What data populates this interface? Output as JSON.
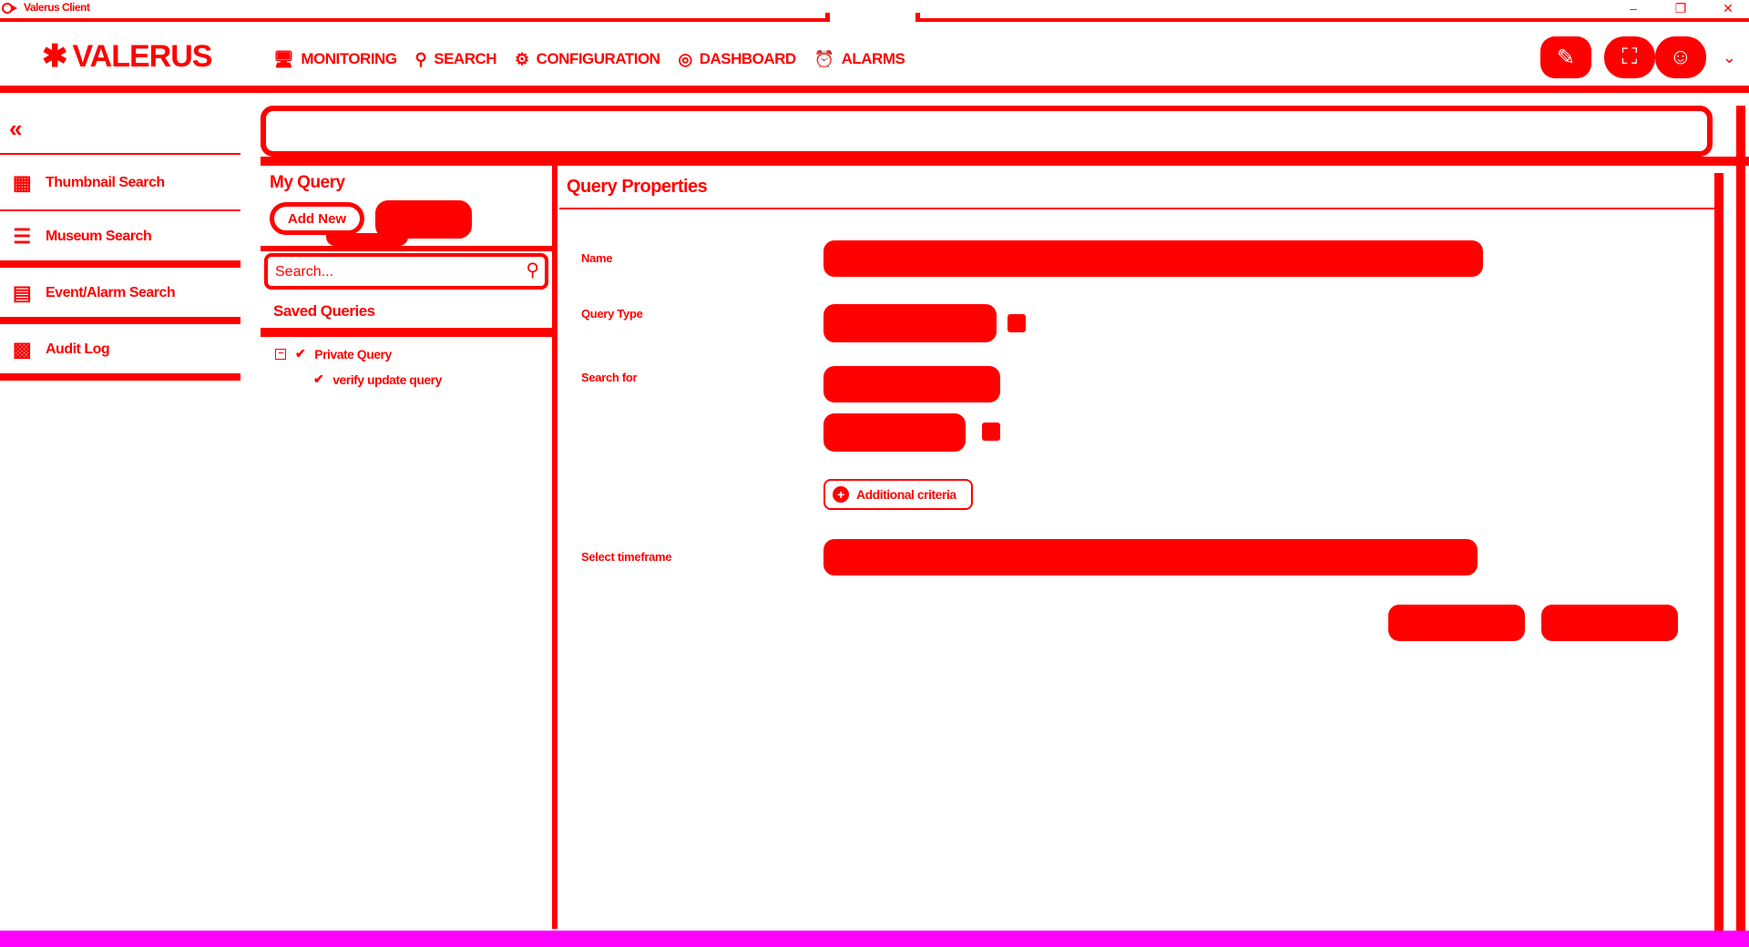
{
  "window": {
    "title": "Valerus Client",
    "controls": [
      "–",
      "❐",
      "✕"
    ]
  },
  "header": {
    "logo_text": "VALERUS",
    "nav": [
      {
        "label": "MONITORING",
        "icon": "monitor-icon"
      },
      {
        "label": "SEARCH",
        "icon": "search-icon",
        "active": true
      },
      {
        "label": "CONFIGURATION",
        "icon": "configuration-icon"
      },
      {
        "label": "DASHBOARD",
        "icon": "dashboard-icon"
      },
      {
        "label": "ALARMS",
        "icon": "alarm-icon"
      }
    ]
  },
  "sidebar": {
    "items": [
      {
        "label": "Thumbnail Search",
        "icon": "thumbnail-grid-icon"
      },
      {
        "label": "Museum Search",
        "icon": "museum-icon"
      },
      {
        "label": "Event/Alarm Search",
        "icon": "event-alarm-icon"
      },
      {
        "label": "Audit Log",
        "icon": "audit-log-icon"
      }
    ]
  },
  "my_query": {
    "title": "My Query",
    "add_new_label": "Add New",
    "search_placeholder": "Search...",
    "saved_title": "Saved Queries",
    "tree": [
      {
        "label": "Private Query",
        "level": 0,
        "toggle": "−"
      },
      {
        "label": "verify update query",
        "level": 1
      }
    ]
  },
  "query_properties": {
    "title": "Query Properties",
    "labels": {
      "name": "Name",
      "query_type": "Query Type",
      "search_for": "Search for",
      "select_timeframe": "Select timeframe"
    },
    "additional_criteria_label": "Additional criteria"
  },
  "colors": {
    "accent": "#ff0000",
    "band": "#ff00ff",
    "background": "#ffffff"
  }
}
